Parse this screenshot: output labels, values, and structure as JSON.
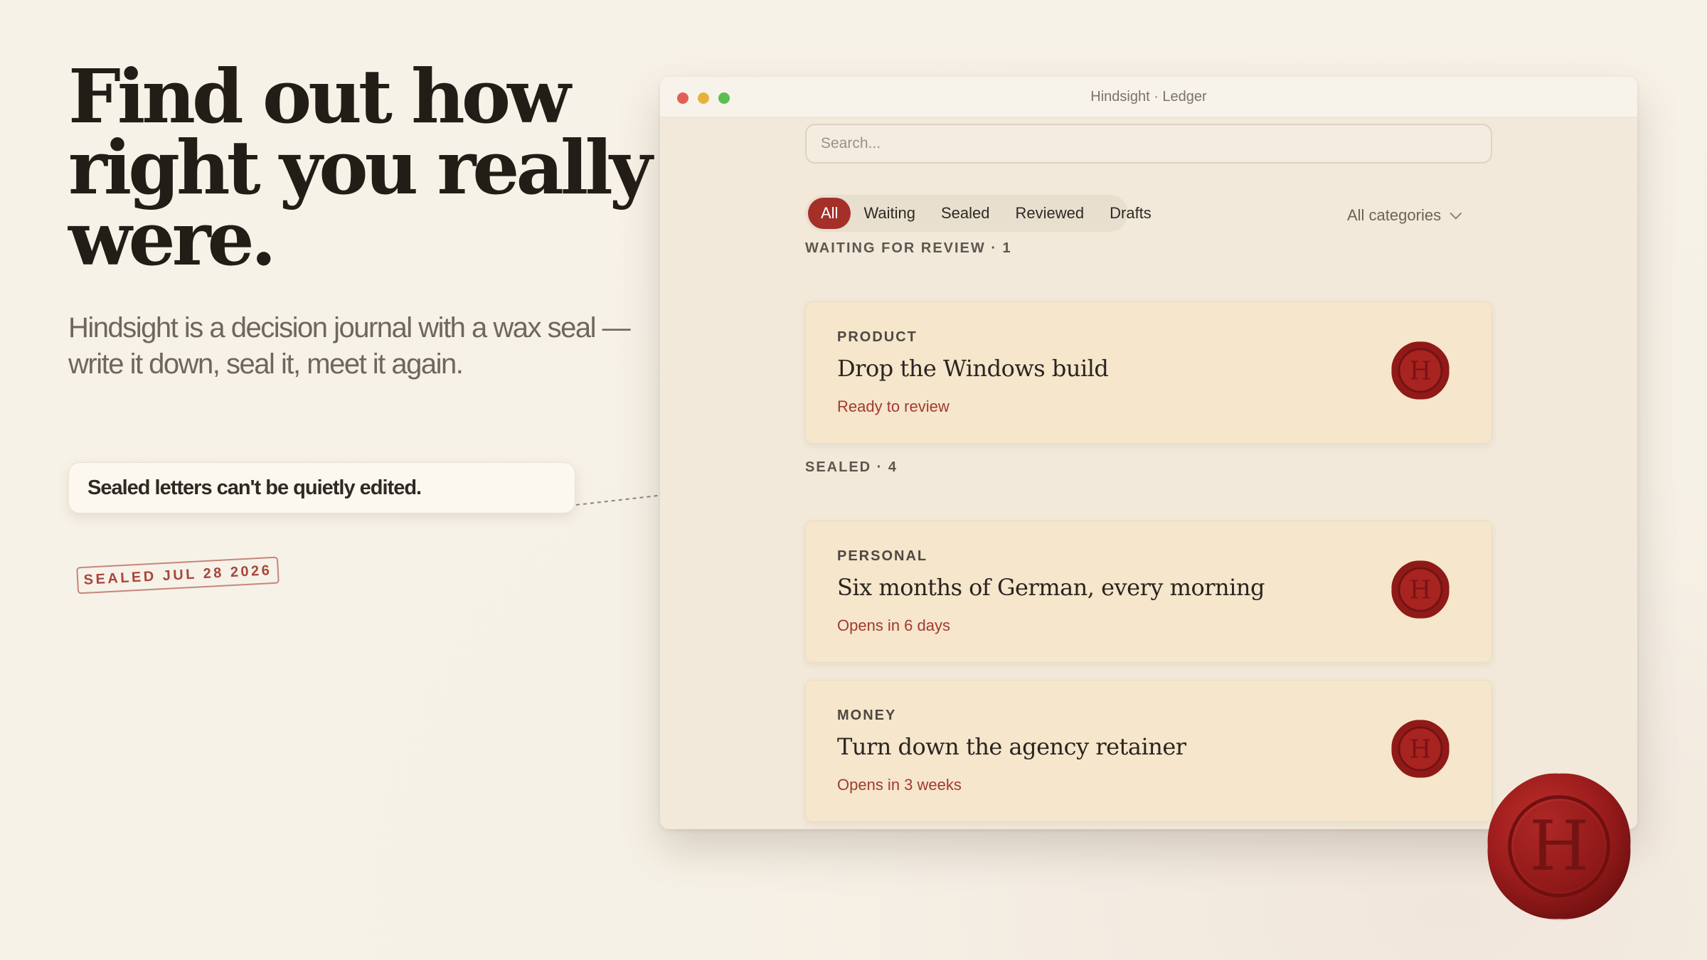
{
  "hero": {
    "title": "Find out how right you really were.",
    "subtitle": "Hindsight is a decision journal with a wax seal — write it down, seal it, meet it again."
  },
  "callout": {
    "text": "Sealed letters can't be quietly edited."
  },
  "stamp": {
    "text": "SEALED JUL 28 2026"
  },
  "window": {
    "title": "Hindsight · Ledger",
    "search": {
      "placeholder": "Search...",
      "value": ""
    },
    "tabs": [
      {
        "label": "All",
        "active": true
      },
      {
        "label": "Waiting",
        "active": false
      },
      {
        "label": "Sealed",
        "active": false
      },
      {
        "label": "Reviewed",
        "active": false
      },
      {
        "label": "Drafts",
        "active": false
      }
    ],
    "category_filter": "All categories",
    "sections": [
      {
        "label": "WAITING FOR REVIEW · 1",
        "cards": [
          {
            "category": "PRODUCT",
            "title": "Drop the Windows build",
            "status": "Ready to review",
            "seal_letter": "H"
          }
        ]
      },
      {
        "label": "SEALED · 4",
        "cards": [
          {
            "category": "PERSONAL",
            "title": "Six months of German, every morning",
            "status": "Opens in 6 days",
            "seal_letter": "H"
          },
          {
            "category": "MONEY",
            "title": "Turn down the agency retainer",
            "status": "Opens in 3 weeks",
            "seal_letter": "H"
          }
        ]
      }
    ]
  },
  "colors": {
    "accent": "#a5302a",
    "wax": "#9b1c1c",
    "background": "#f7f2e8",
    "card": "#f5e6cc"
  },
  "icons": [
    "wax-seal-icon",
    "chevron-down-icon"
  ]
}
